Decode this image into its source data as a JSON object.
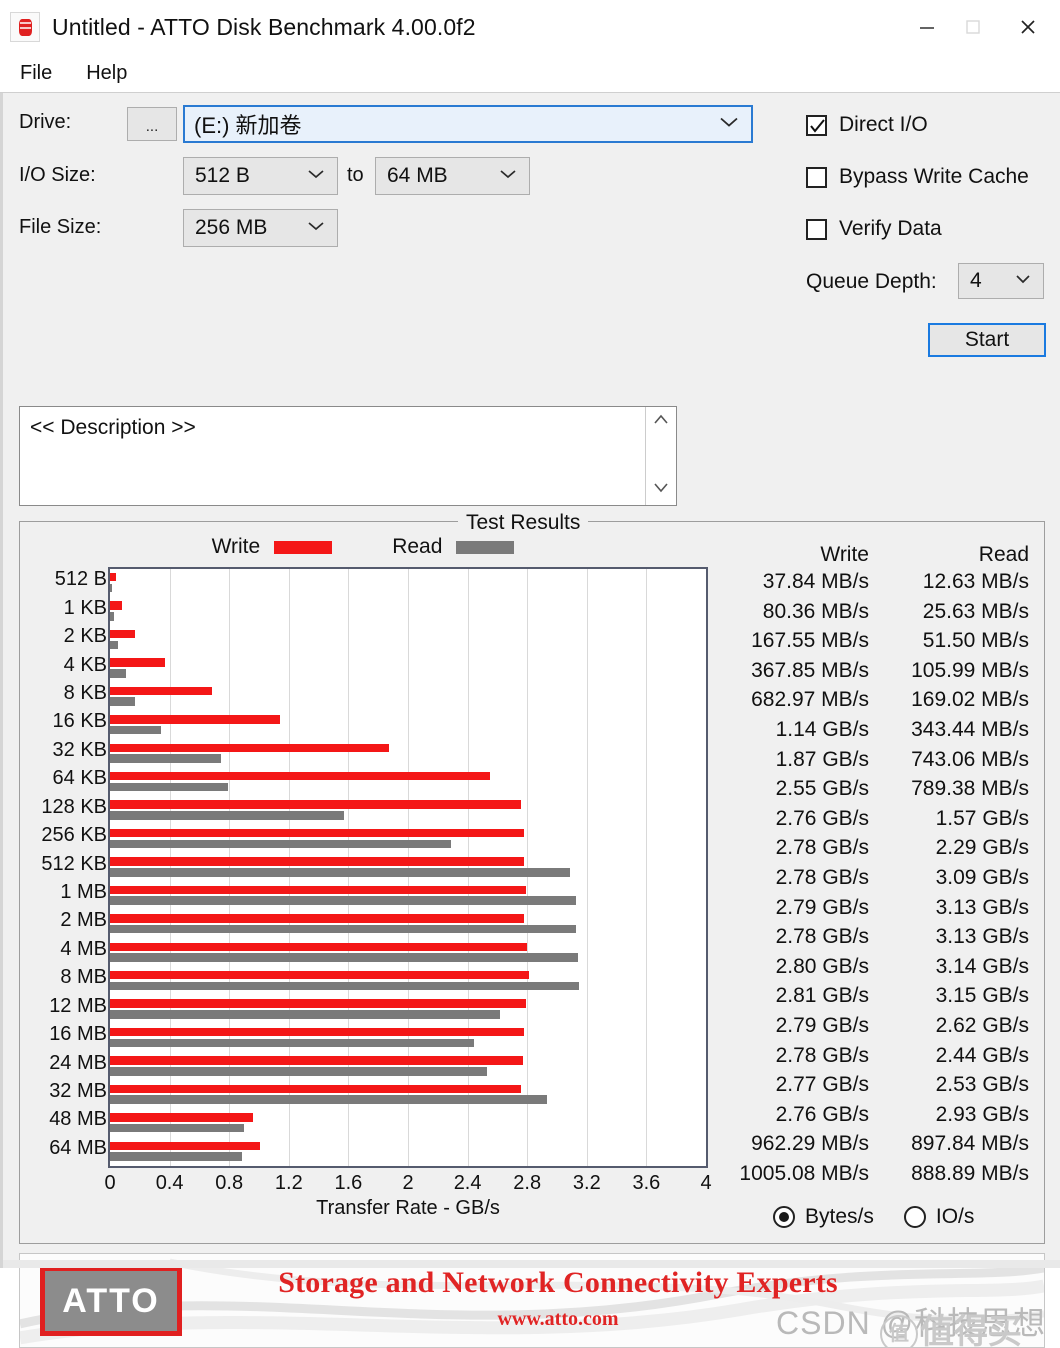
{
  "window": {
    "title": "Untitled - ATTO Disk Benchmark 4.00.0f2",
    "icon": "disk-icon",
    "minimize": "—",
    "maximize": "□",
    "close": "✕"
  },
  "menu": {
    "items": [
      "File",
      "Help"
    ]
  },
  "controls": {
    "drive_label": "Drive:",
    "browse_label": "...",
    "drive_value": "(E:) 新加卷",
    "io_size_label": "I/O Size:",
    "io_size_from": "512 B",
    "io_to_label": "to",
    "io_size_to": "64 MB",
    "file_size_label": "File Size:",
    "file_size_value": "256 MB",
    "direct_io_label": "Direct I/O",
    "direct_io_checked": true,
    "bypass_cache_label": "Bypass Write Cache",
    "bypass_cache_checked": false,
    "verify_data_label": "Verify Data",
    "verify_data_checked": false,
    "queue_depth_label": "Queue Depth:",
    "queue_depth_value": "4",
    "start_label": "Start"
  },
  "description": {
    "text": "<< Description >>"
  },
  "results": {
    "group_title": "Test Results",
    "legend_write": "Write",
    "legend_read": "Read",
    "col_write": "Write",
    "col_read": "Read",
    "rows": [
      {
        "size": "512 B",
        "write": "37.84 MB/s",
        "read": "12.63 MB/s"
      },
      {
        "size": "1 KB",
        "write": "80.36 MB/s",
        "read": "25.63 MB/s"
      },
      {
        "size": "2 KB",
        "write": "167.55 MB/s",
        "read": "51.50 MB/s"
      },
      {
        "size": "4 KB",
        "write": "367.85 MB/s",
        "read": "105.99 MB/s"
      },
      {
        "size": "8 KB",
        "write": "682.97 MB/s",
        "read": "169.02 MB/s"
      },
      {
        "size": "16 KB",
        "write": "1.14 GB/s",
        "read": "343.44 MB/s"
      },
      {
        "size": "32 KB",
        "write": "1.87 GB/s",
        "read": "743.06 MB/s"
      },
      {
        "size": "64 KB",
        "write": "2.55 GB/s",
        "read": "789.38 MB/s"
      },
      {
        "size": "128 KB",
        "write": "2.76 GB/s",
        "read": "1.57 GB/s"
      },
      {
        "size": "256 KB",
        "write": "2.78 GB/s",
        "read": "2.29 GB/s"
      },
      {
        "size": "512 KB",
        "write": "2.78 GB/s",
        "read": "3.09 GB/s"
      },
      {
        "size": "1 MB",
        "write": "2.79 GB/s",
        "read": "3.13 GB/s"
      },
      {
        "size": "2 MB",
        "write": "2.78 GB/s",
        "read": "3.13 GB/s"
      },
      {
        "size": "4 MB",
        "write": "2.80 GB/s",
        "read": "3.14 GB/s"
      },
      {
        "size": "8 MB",
        "write": "2.81 GB/s",
        "read": "3.15 GB/s"
      },
      {
        "size": "12 MB",
        "write": "2.79 GB/s",
        "read": "2.62 GB/s"
      },
      {
        "size": "16 MB",
        "write": "2.78 GB/s",
        "read": "2.44 GB/s"
      },
      {
        "size": "24 MB",
        "write": "2.77 GB/s",
        "read": "2.53 GB/s"
      },
      {
        "size": "32 MB",
        "write": "2.76 GB/s",
        "read": "2.93 GB/s"
      },
      {
        "size": "48 MB",
        "write": "962.29 MB/s",
        "read": "897.84 MB/s"
      },
      {
        "size": "64 MB",
        "write": "1005.08 MB/s",
        "read": "888.89 MB/s"
      }
    ],
    "units_bytes_label": "Bytes/s",
    "units_io_label": "IO/s",
    "units_selected": "Bytes/s"
  },
  "chart_data": {
    "type": "bar",
    "orientation": "horizontal",
    "title": "Test Results",
    "xlabel": "Transfer Rate - GB/s",
    "ylabel": "",
    "xlim": [
      0,
      4
    ],
    "xticks": [
      "0",
      "0.4",
      "0.8",
      "1.2",
      "1.6",
      "2",
      "2.4",
      "2.8",
      "3.2",
      "3.6",
      "4"
    ],
    "grid": true,
    "legend_position": "top",
    "categories": [
      "512 B",
      "1 KB",
      "2 KB",
      "4 KB",
      "8 KB",
      "16 KB",
      "32 KB",
      "64 KB",
      "128 KB",
      "256 KB",
      "512 KB",
      "1 MB",
      "2 MB",
      "4 MB",
      "8 MB",
      "12 MB",
      "16 MB",
      "24 MB",
      "32 MB",
      "48 MB",
      "64 MB"
    ],
    "series": [
      {
        "name": "Write",
        "color": "#f41717",
        "values": [
          0.03784,
          0.08036,
          0.16755,
          0.36785,
          0.68297,
          1.14,
          1.87,
          2.55,
          2.76,
          2.78,
          2.78,
          2.79,
          2.78,
          2.8,
          2.81,
          2.79,
          2.78,
          2.77,
          2.76,
          0.96229,
          1.00508
        ]
      },
      {
        "name": "Read",
        "color": "#7a7a7a",
        "values": [
          0.01263,
          0.02563,
          0.0515,
          0.10599,
          0.16902,
          0.34344,
          0.74306,
          0.78938,
          1.57,
          2.29,
          3.09,
          3.13,
          3.13,
          3.14,
          3.15,
          2.62,
          2.44,
          2.53,
          2.93,
          0.89784,
          0.88889
        ]
      }
    ]
  },
  "banner": {
    "logo_text": "ATTO",
    "tagline": "Storage and Network Connectivity Experts",
    "url": "www.atto.com",
    "watermark_csdn": "CSDN @科技思想",
    "watermark_smzdm": "值得买"
  },
  "colors": {
    "write": "#f41717",
    "read": "#7a7a7a",
    "accent": "#1a7ae0",
    "brand_red": "#e02424"
  }
}
